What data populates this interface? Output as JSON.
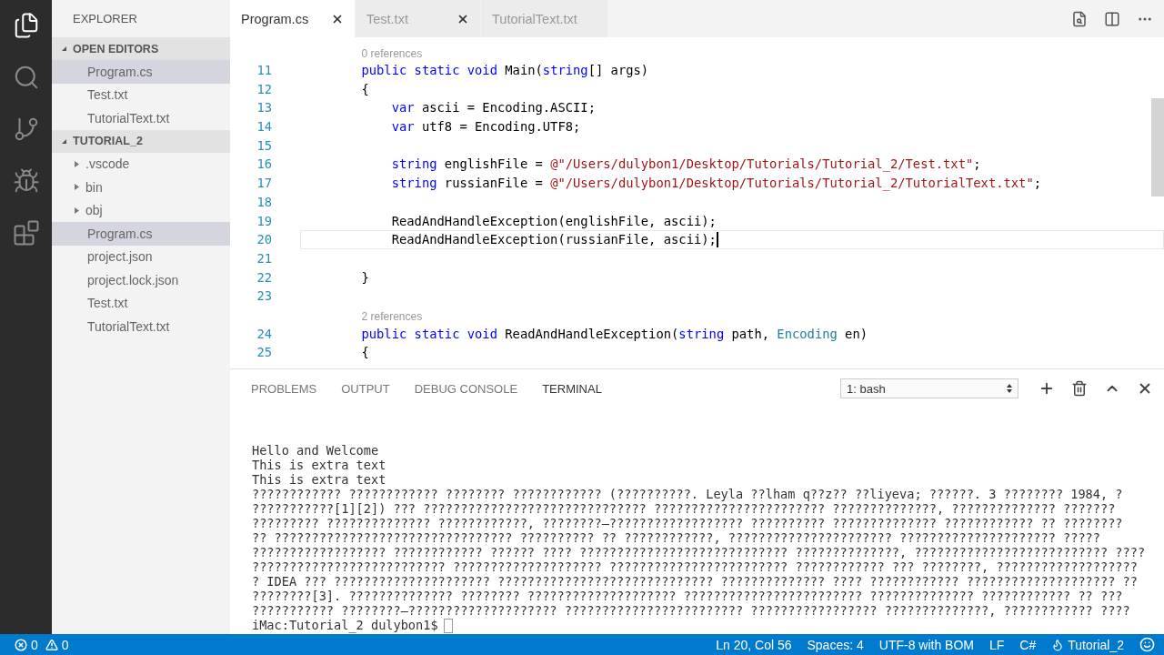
{
  "activity_bar": {
    "items": [
      {
        "kind": "files",
        "selected": true
      },
      {
        "kind": "search",
        "selected": false
      },
      {
        "kind": "git",
        "selected": false
      },
      {
        "kind": "debug",
        "selected": false
      },
      {
        "kind": "extensions",
        "selected": false
      }
    ]
  },
  "sidebar": {
    "title": "EXPLORER",
    "sections": [
      {
        "title": "OPEN EDITORS",
        "expanded": true,
        "items": [
          {
            "label": "Program.cs",
            "kind": "file",
            "selected": true
          },
          {
            "label": "Test.txt",
            "kind": "file",
            "selected": false
          },
          {
            "label": "TutorialText.txt",
            "kind": "file",
            "selected": false
          }
        ]
      },
      {
        "title": "TUTORIAL_2",
        "expanded": true,
        "items": [
          {
            "label": ".vscode",
            "kind": "folder",
            "expanded": false,
            "selected": false
          },
          {
            "label": "bin",
            "kind": "folder",
            "expanded": false,
            "selected": false
          },
          {
            "label": "obj",
            "kind": "folder",
            "expanded": false,
            "selected": false
          },
          {
            "label": "Program.cs",
            "kind": "file",
            "selected": true
          },
          {
            "label": "project.json",
            "kind": "file",
            "selected": false
          },
          {
            "label": "project.lock.json",
            "kind": "file",
            "selected": false
          },
          {
            "label": "Test.txt",
            "kind": "file",
            "selected": false
          },
          {
            "label": "TutorialText.txt",
            "kind": "file",
            "selected": false
          }
        ]
      }
    ]
  },
  "tabs": [
    {
      "label": "Program.cs",
      "selected": true,
      "close_visible": true
    },
    {
      "label": "Test.txt",
      "selected": false,
      "close_visible": true
    },
    {
      "label": "TutorialText.txt",
      "selected": false,
      "close_visible": false
    }
  ],
  "editor": {
    "lines": [
      {
        "kind": "lens",
        "text": "0 references"
      },
      {
        "kind": "code",
        "number": "11",
        "current": false,
        "tokens": [
          {
            "text": "        public static void ",
            "kind": "keyword"
          },
          {
            "text": "Main(",
            "kind": "plain"
          },
          {
            "text": "string",
            "kind": "keyword"
          },
          {
            "text": "[] args)",
            "kind": "plain"
          }
        ]
      },
      {
        "kind": "code",
        "number": "12",
        "current": false,
        "tokens": [
          {
            "text": "        {",
            "kind": "plain"
          }
        ]
      },
      {
        "kind": "code",
        "number": "13",
        "current": false,
        "tokens": [
          {
            "text": "            var ",
            "kind": "keyword"
          },
          {
            "text": "ascii = Encoding.ASCII;",
            "kind": "plain"
          }
        ]
      },
      {
        "kind": "code",
        "number": "14",
        "current": false,
        "tokens": [
          {
            "text": "            var ",
            "kind": "keyword"
          },
          {
            "text": "utf8 = Encoding.UTF8;",
            "kind": "plain"
          }
        ]
      },
      {
        "kind": "code",
        "number": "15",
        "current": false
      },
      {
        "kind": "code",
        "number": "16",
        "current": false,
        "tokens": [
          {
            "text": "            string ",
            "kind": "keyword"
          },
          {
            "text": "englishFile = ",
            "kind": "plain"
          },
          {
            "text": "@\"/Users/dulybon1/Desktop/Tutorials/Tutorial_2/Test.txt\"",
            "kind": "string"
          },
          {
            "text": ";",
            "kind": "plain"
          }
        ]
      },
      {
        "kind": "code",
        "number": "17",
        "current": false,
        "tokens": [
          {
            "text": "            string ",
            "kind": "keyword"
          },
          {
            "text": "russianFile = ",
            "kind": "plain"
          },
          {
            "text": "@\"/Users/dulybon1/Desktop/Tutorials/Tutorial_2/TutorialText.txt\"",
            "kind": "string"
          },
          {
            "text": ";",
            "kind": "plain"
          }
        ]
      },
      {
        "kind": "code",
        "number": "18",
        "current": false
      },
      {
        "kind": "code",
        "number": "19",
        "current": false,
        "tokens": [
          {
            "text": "            ReadAndHandleException(englishFile, ascii);",
            "kind": "plain"
          }
        ]
      },
      {
        "kind": "code",
        "number": "20",
        "current": true,
        "tokens": [
          {
            "text": "            ReadAndHandleException(russianFile, ascii);",
            "kind": "plain"
          }
        ]
      },
      {
        "kind": "code",
        "number": "21",
        "current": false
      },
      {
        "kind": "code",
        "number": "22",
        "current": false,
        "tokens": [
          {
            "text": "        }",
            "kind": "plain"
          }
        ]
      },
      {
        "kind": "code",
        "number": "23",
        "current": false
      },
      {
        "kind": "lens",
        "text": "2 references"
      },
      {
        "kind": "code",
        "number": "24",
        "current": false,
        "tokens": [
          {
            "text": "        public static void ",
            "kind": "keyword"
          },
          {
            "text": "ReadAndHandleException(",
            "kind": "plain"
          },
          {
            "text": "string",
            "kind": "keyword"
          },
          {
            "text": " path, ",
            "kind": "plain"
          },
          {
            "text": "Encoding",
            "kind": "type"
          },
          {
            "text": " en)",
            "kind": "plain"
          }
        ]
      },
      {
        "kind": "code",
        "number": "25",
        "current": false,
        "tokens": [
          {
            "text": "        {",
            "kind": "plain"
          }
        ]
      }
    ]
  },
  "panel": {
    "tabs": [
      {
        "label": "PROBLEMS",
        "selected": false
      },
      {
        "label": "OUTPUT",
        "selected": false
      },
      {
        "label": "DEBUG CONSOLE",
        "selected": false
      },
      {
        "label": "TERMINAL",
        "selected": true
      }
    ],
    "terminal_select": "1: bash",
    "terminal_lines": [
      "Hello and Welcome",
      "This is extra text",
      "This is extra text",
      "???????????? ???????????? ???????? ???????????? (??????????. Leyla ??lham q??z?? ??liyeva; ??????. 3 ???????? 1984, ?",
      "???????????[1][2]) ??? ?????????????????????????????? ??????????????????????? ??????????????, ?????????????? ???????",
      "????????? ?????????????? ????????????, ????????—?????????????????? ?????????? ?????????????? ???????????? ?? ????????",
      "?? ???????????????????????????????? ?????????? ?? ????????????, ?????????????????????? ????????????????????? ?????",
      "?????????????????? ???????????? ?????? ???? ???????????????????????????? ??????????????, ?????????????????????????? ????",
      "?????????????????????????? ???????????????????? ???????????????????????? ???????????? ??? ????????, ???????????????????",
      "? IDEA ??? ????????????????????? ????????????????????????????? ?????????????? ???? ???????????? ???????????????????? ??",
      "????????[3]. ?????????????? ???????? ???????????????????? ???????????????????????? ?????????????? ???????????? ?? ???",
      "??????????? ????????—???????????????????? ???????????????????????? ????????????????? ??????????????, ???????????? ????"
    ],
    "prompt": "iMac:Tutorial_2 dulybon1$"
  },
  "status_bar": {
    "errors": "0",
    "warnings": "0",
    "items": [
      {
        "kind": "text",
        "text": "Ln 20, Col 56"
      },
      {
        "kind": "text",
        "text": "Spaces: 4"
      },
      {
        "kind": "text",
        "text": "UTF-8 with BOM"
      },
      {
        "kind": "text",
        "text": "LF"
      },
      {
        "kind": "text",
        "text": "C#"
      },
      {
        "kind": "project",
        "text": "Tutorial_2"
      },
      {
        "kind": "feedback"
      }
    ]
  }
}
